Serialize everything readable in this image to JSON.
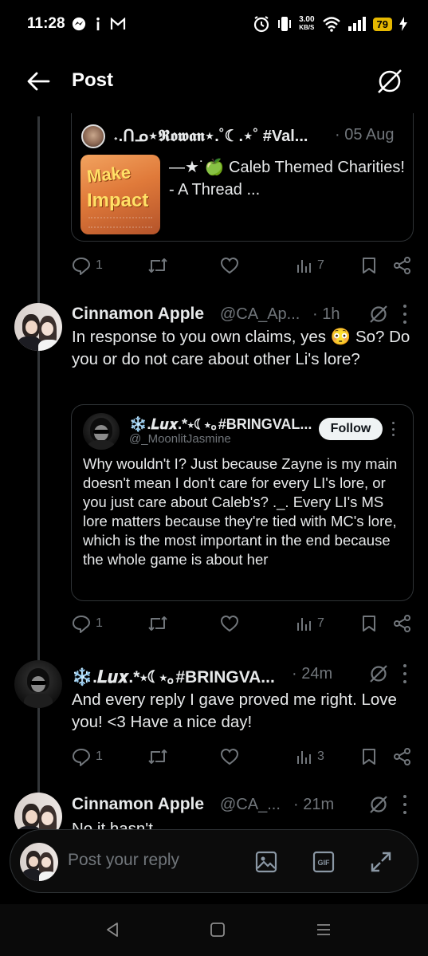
{
  "status_bar": {
    "time": "11:28",
    "net_speed_value": "3.00",
    "net_speed_unit": "KB/S",
    "battery": "79",
    "left_icons": [
      "messenger-icon",
      "info-icon",
      "gmail-icon"
    ],
    "right_icons": [
      "alarm-icon",
      "vibrate-icon",
      "wifi-icon",
      "signal-icon",
      "charging-icon"
    ]
  },
  "header": {
    "title": "Post"
  },
  "quoted_post_1": {
    "name": "˖.ᑎᓄ⋆𝕽𝖔𝖜𝖆𝖓⋆.˚☾.⋆˚ #Val...",
    "date": "· 05 Aug",
    "text": "—★˙🍏 Caleb Themed Charities! - A Thread ...",
    "thumbnail_title_1": "Make",
    "thumbnail_title_2": "Impact",
    "actions": {
      "replies": "1",
      "views": "7"
    }
  },
  "tweet_1": {
    "name": "Cinnamon Apple",
    "handle": "@CA_Ap...",
    "time": "· 1h",
    "text": "In response to you own claims, yes 😳 So? Do you or do not care about other Li's lore?",
    "quote": {
      "name": "❄️.𝑳𝒖𝒙.*⋆☾⋆｡#BRINGVAL...",
      "handle": "@_MoonlitJasmine",
      "follow_label": "Follow",
      "text": "Why wouldn't I? Just because Zayne is my main doesn't mean I don't care for every LI's lore, or you just care about Caleb's? ._. Every LI's MS lore matters because they're tied with MC's lore, which is the most important in the end because the whole game is about her"
    },
    "actions": {
      "replies": "1",
      "views": "7"
    }
  },
  "tweet_2": {
    "name": "❄️.𝑳𝒖𝒙.*⋆☾⋆｡#BRINGVA...",
    "time": "· 24m",
    "text": "And every reply I gave proved me right. Love you! <3 Have a nice day!",
    "actions": {
      "replies": "1",
      "views": "3"
    }
  },
  "tweet_3": {
    "name": "Cinnamon Apple",
    "handle": "@CA_...",
    "time": "· 21m",
    "text": "No it hasn't"
  },
  "reply_bar": {
    "placeholder": "Post your reply"
  }
}
